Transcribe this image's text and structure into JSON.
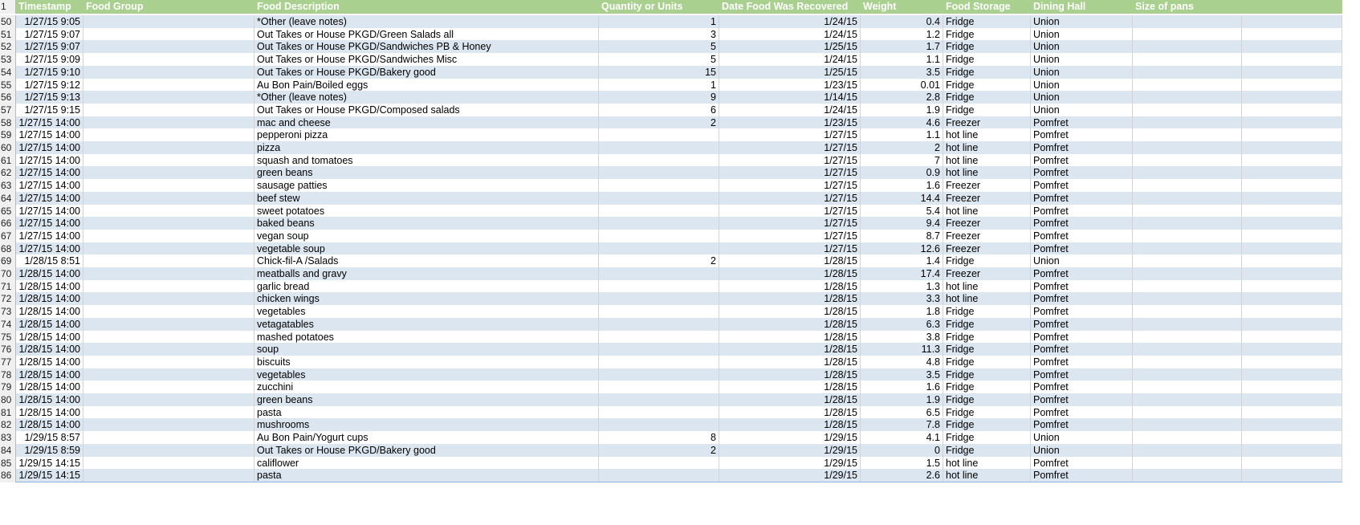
{
  "header": {
    "rownum": "1",
    "columns": [
      "Timestamp",
      "Food Group",
      "Food Description",
      "Quantity or Units",
      "Date Food Was Recovered",
      "Weight",
      "Food Storage",
      "Dining Hall",
      "Size of pans"
    ]
  },
  "rows": [
    {
      "n": "50",
      "ts": "1/27/15 9:05",
      "desc": "*Other (leave notes)",
      "qty": "1",
      "date": "1/24/15",
      "w": "0.4",
      "store": "Fridge",
      "hall": "Union"
    },
    {
      "n": "51",
      "ts": "1/27/15 9:07",
      "desc": "Out Takes or House PKGD/Green Salads all",
      "qty": "3",
      "date": "1/24/15",
      "w": "1.2",
      "store": "Fridge",
      "hall": "Union"
    },
    {
      "n": "52",
      "ts": "1/27/15 9:07",
      "desc": "Out Takes or House PKGD/Sandwiches PB & Honey",
      "qty": "5",
      "date": "1/25/15",
      "w": "1.7",
      "store": "Fridge",
      "hall": "Union"
    },
    {
      "n": "53",
      "ts": "1/27/15 9:09",
      "desc": "Out Takes or House PKGD/Sandwiches Misc",
      "qty": "5",
      "date": "1/24/15",
      "w": "1.1",
      "store": "Fridge",
      "hall": "Union"
    },
    {
      "n": "54",
      "ts": "1/27/15 9:10",
      "desc": "Out Takes or House PKGD/Bakery good",
      "qty": "15",
      "date": "1/25/15",
      "w": "3.5",
      "store": "Fridge",
      "hall": "Union"
    },
    {
      "n": "55",
      "ts": "1/27/15 9:12",
      "desc": "Au Bon Pain/Boiled eggs",
      "qty": "1",
      "date": "1/23/15",
      "w": "0.01",
      "store": "Fridge",
      "hall": "Union"
    },
    {
      "n": "56",
      "ts": "1/27/15 9:13",
      "desc": "*Other (leave notes)",
      "qty": "9",
      "date": "1/14/15",
      "w": "2.8",
      "store": "Fridge",
      "hall": "Union"
    },
    {
      "n": "57",
      "ts": "1/27/15 9:15",
      "desc": "Out Takes or House PKGD/Composed salads",
      "qty": "6",
      "date": "1/24/15",
      "w": "1.9",
      "store": "Fridge",
      "hall": "Union"
    },
    {
      "n": "58",
      "ts": "1/27/15 14:00",
      "desc": "mac and cheese",
      "qty": "2",
      "date": "1/23/15",
      "w": "4.6",
      "store": "Freezer",
      "hall": "Pomfret"
    },
    {
      "n": "59",
      "ts": "1/27/15 14:00",
      "desc": "pepperoni pizza",
      "qty": "",
      "date": "1/27/15",
      "w": "1.1",
      "store": "hot line",
      "hall": "Pomfret"
    },
    {
      "n": "60",
      "ts": "1/27/15 14:00",
      "desc": "pizza",
      "qty": "",
      "date": "1/27/15",
      "w": "2",
      "store": "hot line",
      "hall": "Pomfret"
    },
    {
      "n": "61",
      "ts": "1/27/15 14:00",
      "desc": "squash and tomatoes",
      "qty": "",
      "date": "1/27/15",
      "w": "7",
      "store": "hot line",
      "hall": "Pomfret"
    },
    {
      "n": "62",
      "ts": "1/27/15 14:00",
      "desc": "green beans",
      "qty": "",
      "date": "1/27/15",
      "w": "0.9",
      "store": "hot line",
      "hall": "Pomfret"
    },
    {
      "n": "63",
      "ts": "1/27/15 14:00",
      "desc": "sausage patties",
      "qty": "",
      "date": "1/27/15",
      "w": "1.6",
      "store": "Freezer",
      "hall": "Pomfret"
    },
    {
      "n": "64",
      "ts": "1/27/15 14:00",
      "desc": "beef stew",
      "qty": "",
      "date": "1/27/15",
      "w": "14.4",
      "store": "Freezer",
      "hall": "Pomfret"
    },
    {
      "n": "65",
      "ts": "1/27/15 14:00",
      "desc": "sweet potatoes",
      "qty": "",
      "date": "1/27/15",
      "w": "5.4",
      "store": "hot line",
      "hall": "Pomfret"
    },
    {
      "n": "66",
      "ts": "1/27/15 14:00",
      "desc": "baked beans",
      "qty": "",
      "date": "1/27/15",
      "w": "9.4",
      "store": "Freezer",
      "hall": "Pomfret"
    },
    {
      "n": "67",
      "ts": "1/27/15 14:00",
      "desc": "vegan soup",
      "qty": "",
      "date": "1/27/15",
      "w": "8.7",
      "store": "Freezer",
      "hall": "Pomfret"
    },
    {
      "n": "68",
      "ts": "1/27/15 14:00",
      "desc": "vegetable soup",
      "qty": "",
      "date": "1/27/15",
      "w": "12.6",
      "store": "Freezer",
      "hall": "Pomfret"
    },
    {
      "n": "69",
      "ts": "1/28/15 8:51",
      "desc": "Chick-fil-A /Salads",
      "qty": "2",
      "date": "1/28/15",
      "w": "1.4",
      "store": "Fridge",
      "hall": "Union"
    },
    {
      "n": "70",
      "ts": "1/28/15 14:00",
      "desc": "meatballs and gravy",
      "qty": "",
      "date": "1/28/15",
      "w": "17.4",
      "store": "Freezer",
      "hall": "Pomfret"
    },
    {
      "n": "71",
      "ts": "1/28/15 14:00",
      "desc": "garlic bread",
      "qty": "",
      "date": "1/28/15",
      "w": "1.3",
      "store": "hot line",
      "hall": "Pomfret"
    },
    {
      "n": "72",
      "ts": "1/28/15 14:00",
      "desc": "chicken wings",
      "qty": "",
      "date": "1/28/15",
      "w": "3.3",
      "store": "hot line",
      "hall": "Pomfret"
    },
    {
      "n": "73",
      "ts": "1/28/15 14:00",
      "desc": "vegetables",
      "qty": "",
      "date": "1/28/15",
      "w": "1.8",
      "store": "Fridge",
      "hall": "Pomfret"
    },
    {
      "n": "74",
      "ts": "1/28/15 14:00",
      "desc": "vetagatables",
      "qty": "",
      "date": "1/28/15",
      "w": "6.3",
      "store": "Fridge",
      "hall": "Pomfret"
    },
    {
      "n": "75",
      "ts": "1/28/15 14:00",
      "desc": "mashed potatoes",
      "qty": "",
      "date": "1/28/15",
      "w": "3.8",
      "store": "Fridge",
      "hall": "Pomfret"
    },
    {
      "n": "76",
      "ts": "1/28/15 14:00",
      "desc": "soup",
      "qty": "",
      "date": "1/28/15",
      "w": "11.3",
      "store": "Fridge",
      "hall": "Pomfret"
    },
    {
      "n": "77",
      "ts": "1/28/15 14:00",
      "desc": "biscuits",
      "qty": "",
      "date": "1/28/15",
      "w": "4.8",
      "store": "Fridge",
      "hall": "Pomfret"
    },
    {
      "n": "78",
      "ts": "1/28/15 14:00",
      "desc": "vegetables",
      "qty": "",
      "date": "1/28/15",
      "w": "3.5",
      "store": "Fridge",
      "hall": "Pomfret"
    },
    {
      "n": "79",
      "ts": "1/28/15 14:00",
      "desc": "zucchini",
      "qty": "",
      "date": "1/28/15",
      "w": "1.6",
      "store": "Fridge",
      "hall": "Pomfret"
    },
    {
      "n": "80",
      "ts": "1/28/15 14:00",
      "desc": "green beans",
      "qty": "",
      "date": "1/28/15",
      "w": "1.9",
      "store": "Fridge",
      "hall": "Pomfret"
    },
    {
      "n": "81",
      "ts": "1/28/15 14:00",
      "desc": "pasta",
      "qty": "",
      "date": "1/28/15",
      "w": "6.5",
      "store": "Fridge",
      "hall": "Pomfret"
    },
    {
      "n": "82",
      "ts": "1/28/15 14:00",
      "desc": "mushrooms",
      "qty": "",
      "date": "1/28/15",
      "w": "7.8",
      "store": "Fridge",
      "hall": "Pomfret"
    },
    {
      "n": "83",
      "ts": "1/29/15 8:57",
      "desc": "Au Bon Pain/Yogurt cups",
      "qty": "8",
      "date": "1/29/15",
      "w": "4.1",
      "store": "Fridge",
      "hall": "Union"
    },
    {
      "n": "84",
      "ts": "1/29/15 8:59",
      "desc": "Out Takes or House PKGD/Bakery good",
      "qty": "2",
      "date": "1/29/15",
      "w": "0",
      "store": "Fridge",
      "hall": "Union"
    },
    {
      "n": "85",
      "ts": "1/29/15 14:15",
      "desc": "califlower",
      "qty": "",
      "date": "1/29/15",
      "w": "1.5",
      "store": "hot line",
      "hall": "Pomfret"
    },
    {
      "n": "86",
      "ts": "1/29/15 14:15",
      "desc": "pasta",
      "qty": "",
      "date": "1/29/15",
      "w": "2.6",
      "store": "hot line",
      "hall": "Pomfret"
    }
  ],
  "colors": {
    "header_bg": "#a9d08e",
    "band_even": "#dce6f1",
    "band_odd": "#ffffff",
    "row_border": "#8db4e2"
  }
}
